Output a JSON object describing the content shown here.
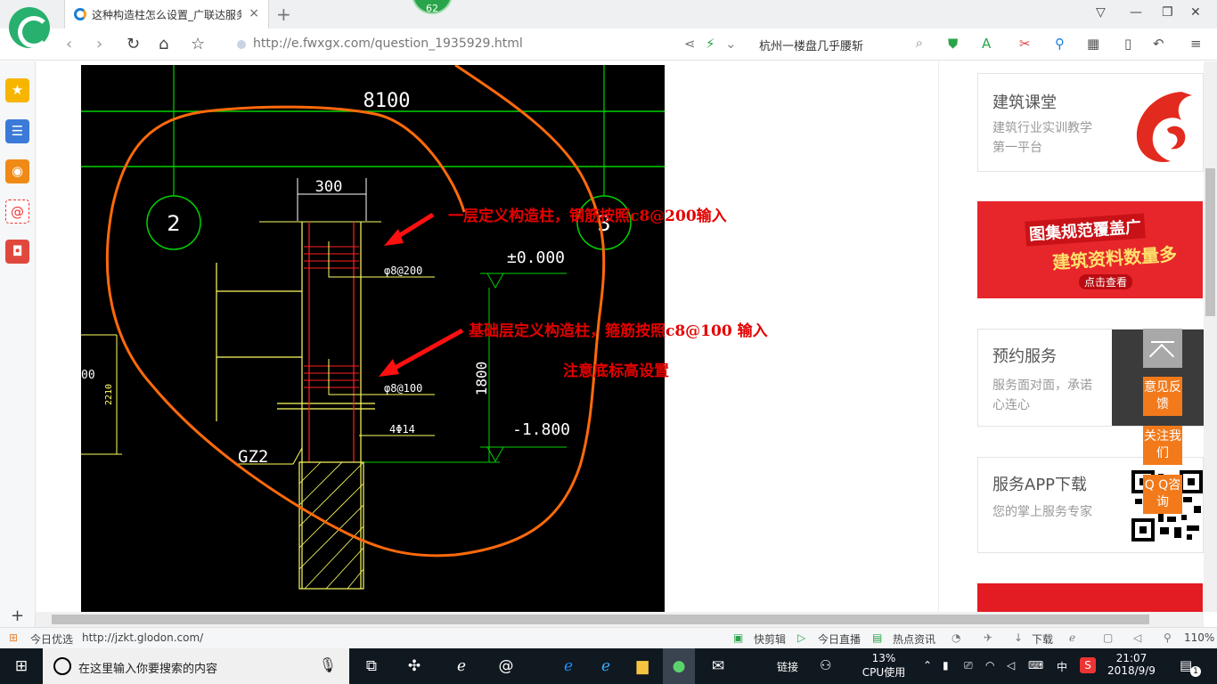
{
  "browser": {
    "tab_title": "这种构造柱怎么设置_广联达服务",
    "tab_close": "×",
    "new_tab": "+",
    "notification_badge": "62",
    "url": "http://e.fwxgx.com/question_1935929.html",
    "search_query": "杭州一楼盘几乎腰斩"
  },
  "cad_drawing": {
    "dim_8100": "8100",
    "axis_2": "2",
    "axis_3": "3",
    "dim_300": "300",
    "stirrup_upper": "φ8@200",
    "stirrup_lower": "φ8@100",
    "level_top": "±0.000",
    "dim_1800": "1800",
    "level_bottom": "-1.800",
    "rebar_main": "4Φ14",
    "column_tag": "GZ2",
    "dim_2210": "2210",
    "left_dim_cut": "00"
  },
  "annotations": {
    "upper_note": "一层定义构造柱，钢筋按照c8@200输入",
    "lower_note": "基础层定义构造柱，箍筋按照c8@100 输入",
    "elevation_note": "注意底标高设置"
  },
  "right_column": {
    "course_title": "建筑课堂",
    "course_desc": "建筑行业实训教学第一平台",
    "banner_line1": "图集规范覆盖广",
    "banner_line2": "建筑资料数量多",
    "banner_button": "点击查看",
    "booking_title": "预约服务",
    "booking_desc": "服务面对面，承诺心连心",
    "app_title": "服务APP下载",
    "app_desc": "您的掌上服务专家"
  },
  "float_buttons": {
    "feedback": "意见反馈",
    "follow": "关注我们",
    "qq": "Q Q咨询"
  },
  "status_bar": {
    "news": "今日优选",
    "link_url": "http://jzkt.glodon.com/",
    "quick_clip": "快剪辑",
    "live": "今日直播",
    "hot_news": "热点资讯",
    "download": "下载",
    "zoom": "110%"
  },
  "taskbar": {
    "search_placeholder": "在这里输入你要搜索的内容",
    "links": "链接",
    "cpu_percent": "13%",
    "cpu_label": "CPU使用",
    "ime": "中",
    "time": "21:07",
    "date": "2018/9/9",
    "notification_count": "1"
  }
}
